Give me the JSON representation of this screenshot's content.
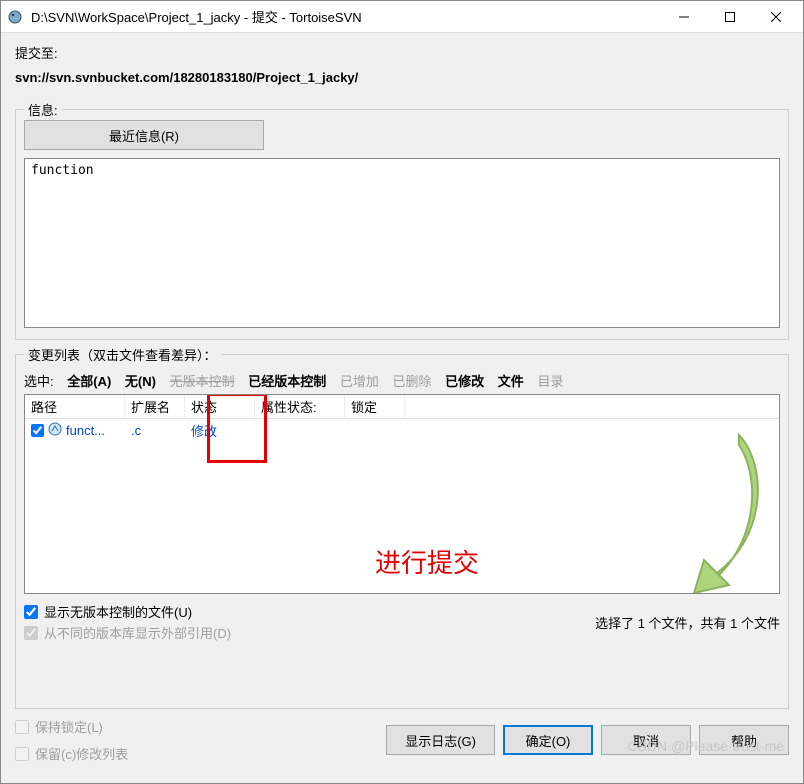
{
  "titlebar": {
    "title": "D:\\SVN\\WorkSpace\\Project_1_jacky - 提交 - TortoiseSVN"
  },
  "commit_to_label": "提交至:",
  "url": "svn://svn.svnbucket.com/18280183180/Project_1_jacky/",
  "info": {
    "legend": "信息:",
    "recent_button": "最近信息(R)",
    "message": "function"
  },
  "changelist": {
    "legend": "变更列表（双击文件查看差异）：",
    "filters": {
      "selected_label": "选中:",
      "all": "全部(A)",
      "none": "无(N)",
      "no_version": "无版本控制",
      "versioned": "已经版本控制",
      "added": "已增加",
      "deleted": "已删除",
      "modified": "已修改",
      "files": "文件",
      "dirs": "目录"
    },
    "columns": {
      "path": "路径",
      "ext": "扩展名",
      "status": "状态",
      "prop": "属性状态:",
      "lock": "锁定"
    },
    "rows": [
      {
        "checked": true,
        "name": "funct...",
        "ext": ".c",
        "status": "修改",
        "prop": "",
        "lock": ""
      }
    ],
    "annotation": "进行提交",
    "status_text": "选择了 1 个文件，共有 1 个文件"
  },
  "options": {
    "show_unversioned": {
      "label": "显示无版本控制的文件(U)",
      "checked": true
    },
    "show_externals": {
      "label": "从不同的版本库显示外部引用(D)",
      "checked": true
    },
    "keep_lock": {
      "label": "保持锁定(L)",
      "checked": false
    },
    "keep_changelist": {
      "label": "保留(c)修改列表",
      "checked": false
    }
  },
  "buttons": {
    "showlog": "显示日志(G)",
    "ok": "确定(O)",
    "cancel": "取消",
    "help": "帮助"
  },
  "watermark": "CSDN @Please·trust·me"
}
